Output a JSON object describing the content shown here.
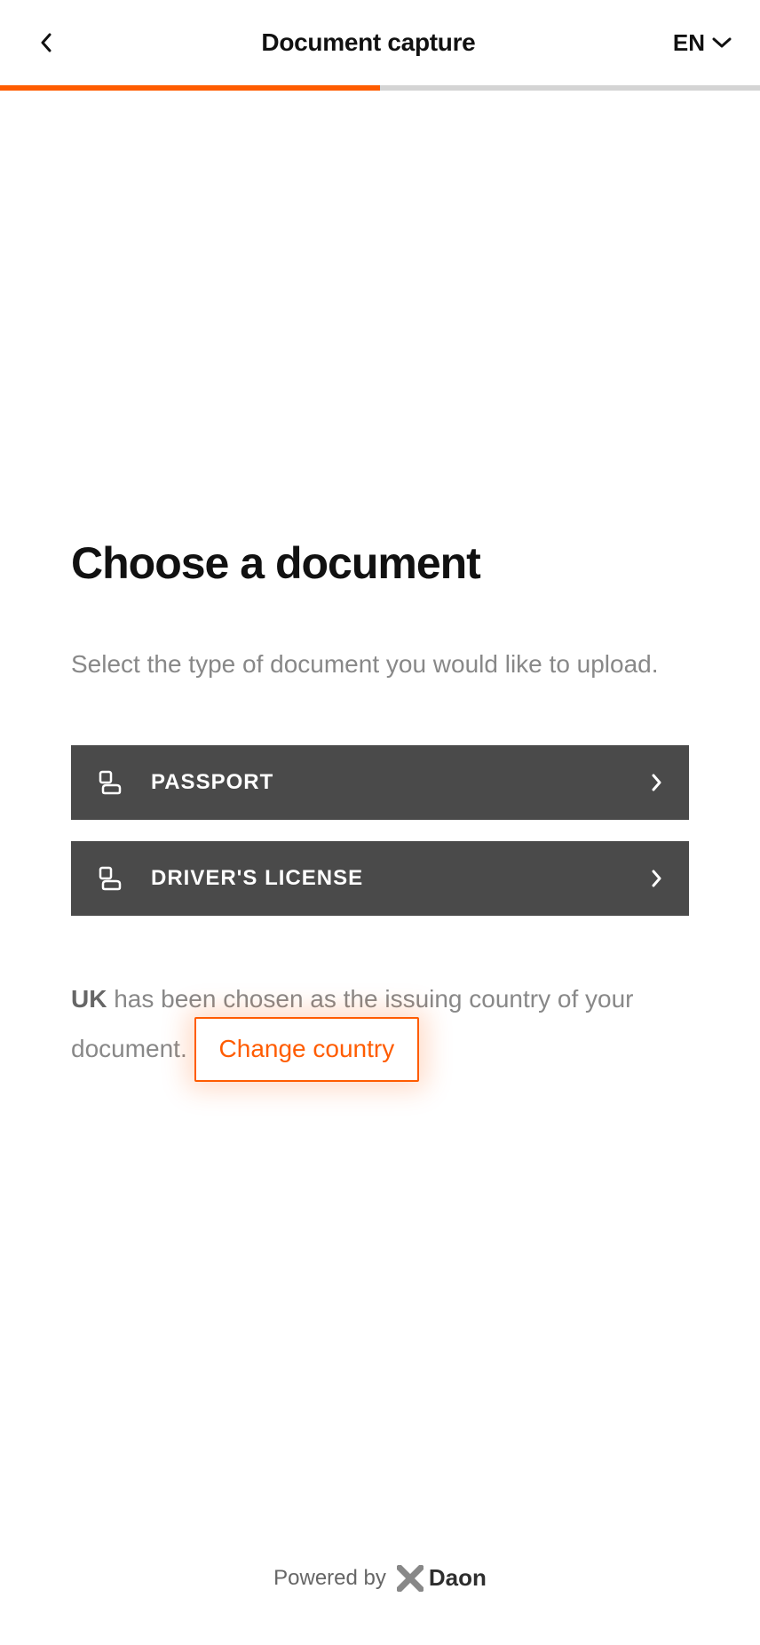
{
  "header": {
    "title": "Document capture",
    "language": "EN"
  },
  "progress": {
    "percent": 50
  },
  "main": {
    "title": "Choose a document",
    "description": "Select the type of document you would like to upload.",
    "documents": [
      {
        "label": "PASSPORT"
      },
      {
        "label": "DRIVER'S LICENSE"
      }
    ],
    "country": {
      "code": "UK",
      "text_before": " has been chosen as the issuing country of your document. ",
      "change_label": "Change country"
    }
  },
  "footer": {
    "powered_by": "Powered by",
    "brand": "Daon"
  }
}
